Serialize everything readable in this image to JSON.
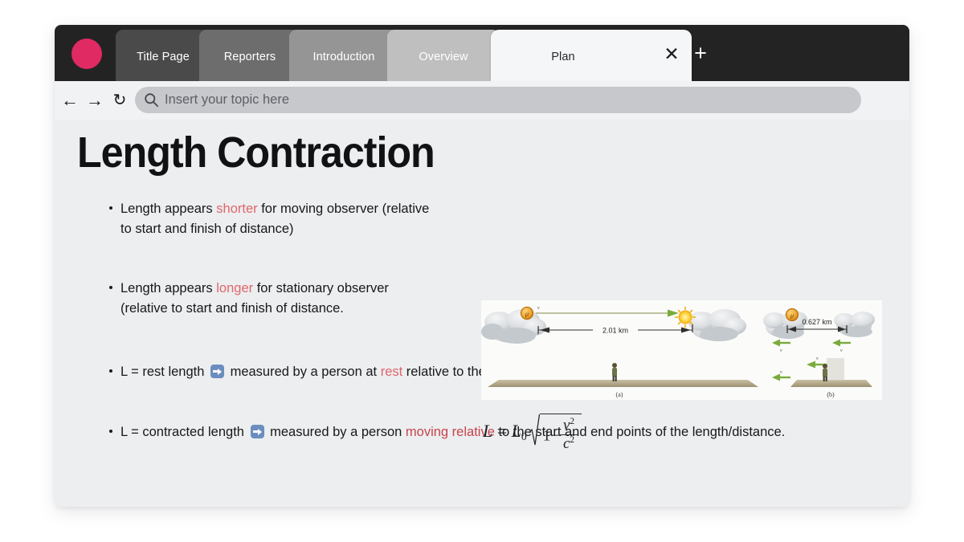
{
  "browser": {
    "brand_color": "#e02a63",
    "tabs": [
      {
        "label": "Title Page",
        "active": false
      },
      {
        "label": "Reporters",
        "active": false
      },
      {
        "label": "Introduction",
        "active": false
      },
      {
        "label": "Overview",
        "active": false
      },
      {
        "label": "Plan",
        "active": true
      }
    ],
    "tab_close_glyph": "✕",
    "new_tab_glyph": "+",
    "toolbar": {
      "back_glyph": "←",
      "forward_glyph": "→",
      "reload_glyph": "↻",
      "search_placeholder": "Insert your topic here",
      "search_value": ""
    }
  },
  "slide": {
    "title": "Length Contraction",
    "highlight_color": "#e0676b",
    "bullets": [
      {
        "id": "bullet-1",
        "parts": [
          {
            "text": "Length appears ",
            "style": "normal"
          },
          {
            "text": "shorter",
            "style": "highlight"
          },
          {
            "text": " for moving observer (relative to start and finish of distance)",
            "style": "normal"
          }
        ]
      },
      {
        "id": "bullet-2",
        "parts": [
          {
            "text": "Length appears ",
            "style": "normal"
          },
          {
            "text": "longer",
            "style": "highlight"
          },
          {
            "text": " for stationary observer (relative to start and finish of distance.",
            "style": "normal"
          }
        ]
      },
      {
        "id": "bullet-3",
        "parts": [
          {
            "text": "L = rest length ",
            "style": "normal"
          },
          {
            "text": "➡",
            "style": "arrow-icon"
          },
          {
            "text": " measured by a person at ",
            "style": "normal"
          },
          {
            "text": "rest",
            "style": "highlight"
          },
          {
            "text": " relative to the start and end points of the length/distance.",
            "style": "normal"
          }
        ]
      },
      {
        "id": "bullet-4",
        "parts": [
          {
            "text": "L = contracted length ",
            "style": "normal"
          },
          {
            "text": "➡",
            "style": "arrow-icon"
          },
          {
            "text": " measured by a person ",
            "style": "normal"
          },
          {
            "text": "moving relative",
            "style": "highlight-strong"
          },
          {
            "text": " to the start and end points of the length/distance.",
            "style": "normal"
          }
        ]
      }
    ],
    "formula": {
      "plain": "L = L₀ √(1 − v²/c²)",
      "lhs": "L",
      "equals": "=",
      "rhs_symbol": "L",
      "rhs_subscript": "0",
      "radicand_lead": "1",
      "minus": "−",
      "frac_numerator": "v",
      "frac_numerator_exp": "2",
      "frac_denominator": "c",
      "frac_denominator_exp": "2"
    },
    "figure": {
      "alt": "Muon length contraction diagram: clouds, muon, observer on ground",
      "muon_symbol": "μ",
      "velocity_symbol": "v",
      "distance_a": "2.01 km",
      "distance_b": "0.627 km",
      "caption_a": "(a)",
      "caption_b": "(b)"
    }
  }
}
